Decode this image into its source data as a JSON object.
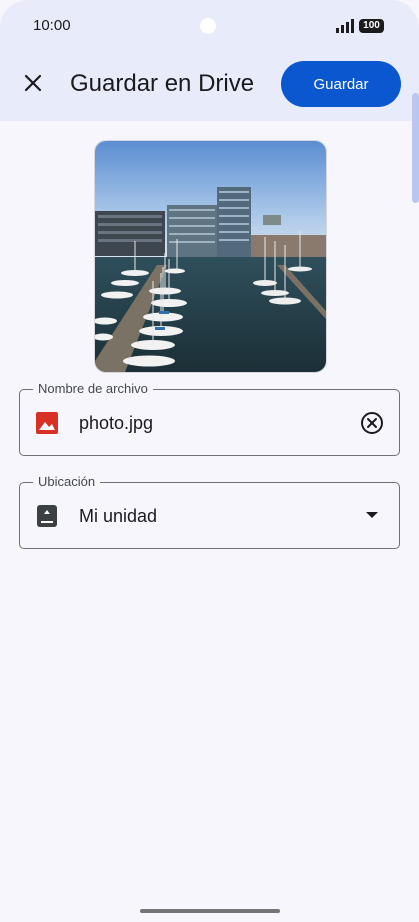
{
  "status_bar": {
    "time": "10:00",
    "battery": "100"
  },
  "header": {
    "title": "Guardar en Drive",
    "save_label": "Guardar"
  },
  "filename_field": {
    "label": "Nombre de archivo",
    "value": "photo.jpg",
    "icon": "image-file-icon",
    "icon_color": "#d93025"
  },
  "location_field": {
    "label": "Ubicación",
    "value": "Mi unidad",
    "icon": "drive-icon"
  },
  "colors": {
    "accent": "#0b57d0",
    "header_bg": "#e8ebfa",
    "page_bg": "#f7f6fd"
  }
}
